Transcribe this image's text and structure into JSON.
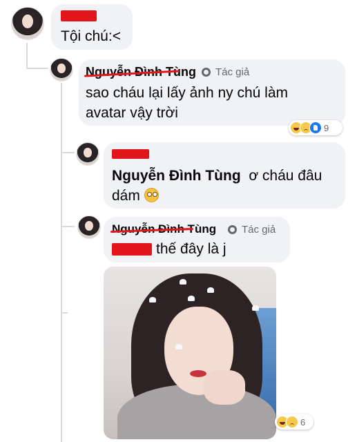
{
  "comments": [
    {
      "text": "Tội chú:<"
    },
    {
      "author": "Nguyễn Đình Tùng",
      "badge": "Tác giả",
      "text": "sao cháu lại lấy ảnh ny chú làm avatar vậy trời",
      "reactions": {
        "icons": [
          "haha-icon",
          "sad-icon",
          "like-icon"
        ],
        "count": "9"
      }
    },
    {
      "mention": "Nguyễn Đình Tùng",
      "text": "ơ cháu đâu dám",
      "emoji": "flushed-face-icon"
    },
    {
      "author": "Nguyễn Đình Tùng",
      "badge": "Tác giả",
      "text": "thế đây là j",
      "photo": "photo-of-girl",
      "reactions": {
        "icons": [
          "haha-icon",
          "sad-icon"
        ],
        "count": "6"
      }
    }
  ],
  "colors": {
    "bubble": "#f0f2f5",
    "redaction": "#e0161b",
    "muted": "#65676b",
    "thread_line": "#d6d9dd"
  }
}
